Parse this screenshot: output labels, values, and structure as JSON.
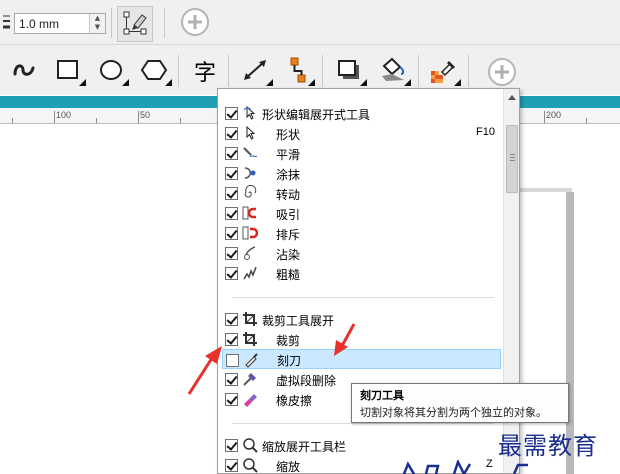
{
  "toolbar1": {
    "width_value": "1.0 mm",
    "width_icon": "pen-width-icon",
    "node_icon": "edit-nodes-icon",
    "add_icon": "add-icon"
  },
  "toolbar2": {
    "tools": [
      {
        "icon": "freehand-curve-icon"
      },
      {
        "icon": "rectangle-icon"
      },
      {
        "icon": "ellipse-icon"
      },
      {
        "icon": "polygon-icon"
      },
      {
        "label": "字",
        "icon": "text-tool-icon"
      },
      {
        "icon": "dimension-icon"
      },
      {
        "icon": "connector-icon"
      },
      {
        "icon": "drop-shadow-icon"
      },
      {
        "icon": "fill-icon"
      },
      {
        "icon": "eyedropper-icon"
      },
      {
        "icon": "add-icon"
      }
    ]
  },
  "ruler": {
    "labels": [
      "100",
      "50",
      "200"
    ]
  },
  "menu": {
    "items": [
      {
        "label": "形状编辑展开式工具",
        "checked": true,
        "icon": "shape-flyout-icon",
        "indent": 0
      },
      {
        "label": "形状",
        "checked": true,
        "icon": "shape-tool-icon",
        "indent": 1,
        "shortcut": "F10"
      },
      {
        "label": "平滑",
        "checked": true,
        "icon": "smooth-icon",
        "indent": 1
      },
      {
        "label": "涂抹",
        "checked": true,
        "icon": "smear-icon",
        "indent": 1
      },
      {
        "label": "转动",
        "checked": true,
        "icon": "twirl-icon",
        "indent": 1
      },
      {
        "label": "吸引",
        "checked": true,
        "icon": "attract-icon",
        "indent": 1
      },
      {
        "label": "排斥",
        "checked": true,
        "icon": "repel-icon",
        "indent": 1
      },
      {
        "label": "沾染",
        "checked": true,
        "icon": "smudge-icon",
        "indent": 1
      },
      {
        "label": "粗糙",
        "checked": true,
        "icon": "roughen-icon",
        "indent": 1
      },
      {
        "label": "裁剪工具展开",
        "checked": true,
        "icon": "crop-flyout-icon",
        "indent": 0
      },
      {
        "label": "裁剪",
        "checked": true,
        "icon": "crop-icon",
        "indent": 1
      },
      {
        "label": "刻刀",
        "checked": false,
        "icon": "knife-icon",
        "indent": 1,
        "highlighted": true
      },
      {
        "label": "虚拟段删除",
        "checked": true,
        "icon": "virtual-segment-delete-icon",
        "indent": 1
      },
      {
        "label": "橡皮擦",
        "checked": true,
        "icon": "eraser-icon",
        "indent": 1
      },
      {
        "label": "缩放展开工具栏",
        "checked": true,
        "icon": "zoom-flyout-icon",
        "indent": 0
      },
      {
        "label": "缩放",
        "checked": true,
        "icon": "zoom-icon",
        "indent": 1,
        "shortcut": "Z"
      }
    ]
  },
  "tooltip": {
    "title": "刻刀工具",
    "description": "切割对象将其分割为两个独立的对象。"
  },
  "watermark": "最需教育",
  "colors": {
    "accent_ruler": "#1e9fb4",
    "highlight": "#cce8ff",
    "annotation_arrow": "#e8312a",
    "watermark": "#1a2e8e"
  }
}
